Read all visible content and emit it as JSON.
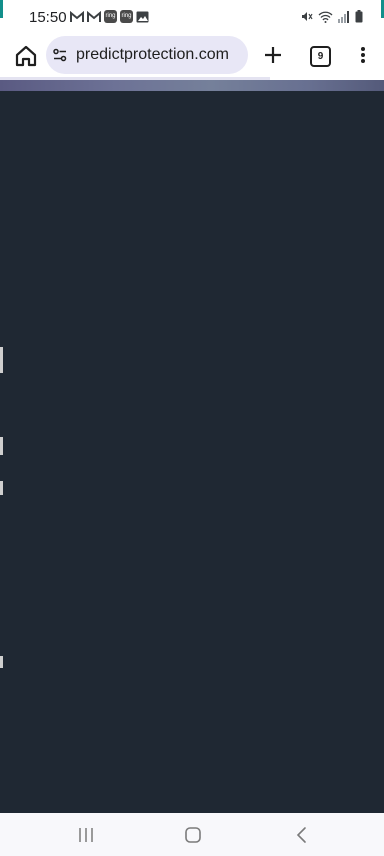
{
  "status_bar": {
    "time": "15:50",
    "notification_icons": [
      "gmail-icon",
      "gmail-icon",
      "ring-icon",
      "ring-icon",
      "image-icon"
    ],
    "ring_label": "ring",
    "system_icons": [
      "mute-icon",
      "wifi-icon",
      "signal-icon",
      "battery-icon"
    ]
  },
  "browser": {
    "url": "predictprotection.com",
    "tab_count": "9"
  },
  "navigation": {
    "buttons": [
      "recent-apps-icon",
      "home-icon",
      "back-icon"
    ]
  }
}
